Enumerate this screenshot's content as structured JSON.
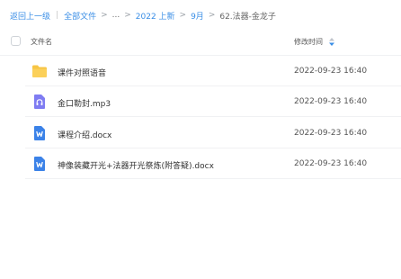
{
  "breadcrumb": {
    "back": "返回上一级",
    "all_files": "全部文件",
    "ellipsis": "...",
    "items": [
      "2022 上新",
      "9月"
    ],
    "current": "62.法器-金龙子"
  },
  "table": {
    "col_name": "文件名",
    "col_date": "修改时间"
  },
  "files": [
    {
      "name": "课件对照语音",
      "date": "2022-09-23 16:40",
      "icon": "folder-icon"
    },
    {
      "name": "金口勒封.mp3",
      "date": "2022-09-23 16:40",
      "icon": "audio-file-icon"
    },
    {
      "name": "课程介绍.docx",
      "date": "2022-09-23 16:40",
      "icon": "word-doc-icon"
    },
    {
      "name": "神像装藏开光+法器开光祭炼(附答疑).docx",
      "date": "2022-09-23 16:40",
      "icon": "word-doc-icon"
    }
  ],
  "colors": {
    "accent": "#3a8ee6",
    "folder": "#f7c544",
    "audio": "#7f7cf2",
    "word": "#3b82e8"
  }
}
